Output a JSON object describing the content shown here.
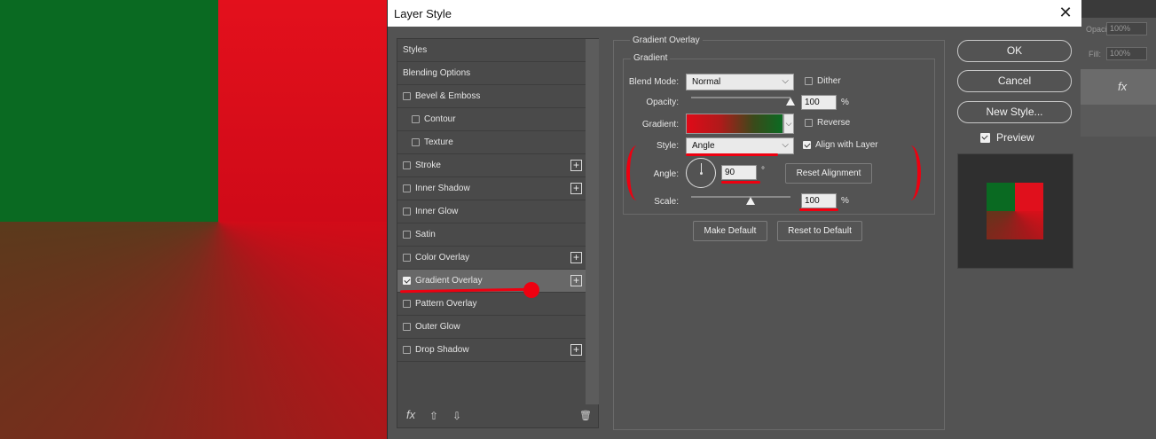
{
  "dialog": {
    "title": "Layer Style",
    "close_glyph": "✕"
  },
  "styles_list": {
    "items": [
      {
        "label": "Styles",
        "type": "header"
      },
      {
        "label": "Blending Options",
        "type": "header"
      },
      {
        "label": "Bevel & Emboss",
        "checked": false,
        "plus": false,
        "indent": 0
      },
      {
        "label": "Contour",
        "checked": false,
        "plus": false,
        "indent": 1
      },
      {
        "label": "Texture",
        "checked": false,
        "plus": false,
        "indent": 1
      },
      {
        "label": "Stroke",
        "checked": false,
        "plus": true,
        "indent": 0
      },
      {
        "label": "Inner Shadow",
        "checked": false,
        "plus": true,
        "indent": 0
      },
      {
        "label": "Inner Glow",
        "checked": false,
        "plus": false,
        "indent": 0
      },
      {
        "label": "Satin",
        "checked": false,
        "plus": false,
        "indent": 0
      },
      {
        "label": "Color Overlay",
        "checked": false,
        "plus": true,
        "indent": 0
      },
      {
        "label": "Gradient Overlay",
        "checked": true,
        "plus": true,
        "indent": 0,
        "selected": true
      },
      {
        "label": "Pattern Overlay",
        "checked": false,
        "plus": false,
        "indent": 0
      },
      {
        "label": "Outer Glow",
        "checked": false,
        "plus": false,
        "indent": 0
      },
      {
        "label": "Drop Shadow",
        "checked": false,
        "plus": true,
        "indent": 0
      }
    ],
    "footer": {
      "fx": "fx",
      "up": "⇧",
      "down": "⇩",
      "trash": "🗑"
    }
  },
  "gradient_overlay": {
    "section_title": "Gradient Overlay",
    "group_title": "Gradient",
    "blend_mode_label": "Blend Mode:",
    "blend_mode_value": "Normal",
    "dither_label": "Dither",
    "dither_checked": false,
    "opacity_label": "Opacity:",
    "opacity_value": "100",
    "opacity_unit": "%",
    "opacity_fraction": 1.0,
    "gradient_label": "Gradient:",
    "reverse_label": "Reverse",
    "reverse_checked": false,
    "style_label": "Style:",
    "style_value": "Angle",
    "align_label": "Align with Layer",
    "align_checked": true,
    "angle_label": "Angle:",
    "angle_value": "90",
    "angle_unit": "°",
    "reset_alignment_label": "Reset Alignment",
    "scale_label": "Scale:",
    "scale_value": "100",
    "scale_unit": "%",
    "scale_fraction": 0.6,
    "make_default_label": "Make Default",
    "reset_default_label": "Reset to Default"
  },
  "buttons": {
    "ok": "OK",
    "cancel": "Cancel",
    "new_style": "New Style...",
    "preview_label": "Preview",
    "preview_checked": true
  },
  "layers_panel": {
    "opacity_label": "Opacity:",
    "opacity_value": "100%",
    "fill_label": "Fill:",
    "fill_value": "100%",
    "fx": "fx"
  },
  "colors": {
    "annotation_red": "#ee0010",
    "canvas_green": "#0a6a22",
    "canvas_red": "#e0101c"
  }
}
